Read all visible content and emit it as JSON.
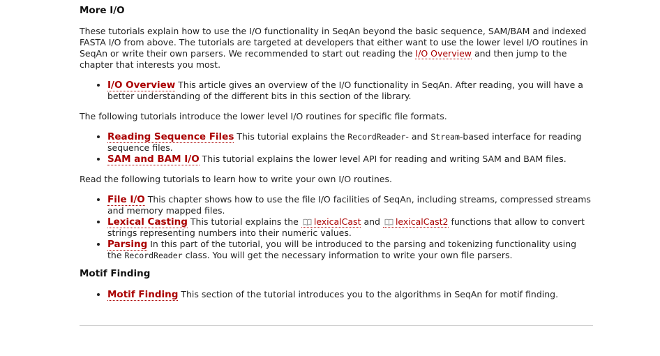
{
  "section_io": {
    "title": "More I/O",
    "intro_part1": "These tutorials explain how to use the I/O functionality in SeqAn beyond the basic sequence, SAM/BAM and indexed FASTA I/O from above. The tutorials are targeted at developers that either want to use the lower level I/O routines in SeqAn or write their own parsers. We recommended to start out reading the ",
    "intro_link": "I/O Overview",
    "intro_part2": " and then jump to the chapter that interests you most.",
    "overview_item": {
      "link": "I/O Overview",
      "text": " This article gives an overview of the I/O functionality in SeqAn. After reading, you will have a better understanding of the different bits in this section of the library."
    },
    "lower_level_intro": "The following tutorials introduce the lower level I/O routines for specific file formats.",
    "lower_level_items": [
      {
        "link": "Reading Sequence Files",
        "text_before": " This tutorial explains the ",
        "code1": "RecordReader",
        "text_middle": "- and ",
        "code2": "Stream",
        "text_after": "-based interface for reading sequence files."
      },
      {
        "link": "SAM and BAM I/O",
        "text": " This tutorial explains the lower level API for reading and writing SAM and BAM files."
      }
    ],
    "own_routines_intro": "Read the following tutorials to learn how to write your own I/O routines.",
    "own_routines_items": [
      {
        "link": "File I/O",
        "text": " This chapter shows how to use the file I/O facilities of SeqAn, including streams, compressed streams and memory mapped files."
      },
      {
        "link": "Lexical Casting",
        "text_before": " This tutorial explains the ",
        "api1": "lexicalCast",
        "text_middle": " and ",
        "api2": "lexicalCast2",
        "text_after": " functions that allow to convert strings representing numbers into their numeric values."
      },
      {
        "link": "Parsing",
        "text_before": " In this part of the tutorial, you will be introduced to the parsing and tokenizing functionality using the ",
        "code": "RecordReader",
        "text_after": " class. You will get the necessary information to write your own file parsers."
      }
    ]
  },
  "section_motif": {
    "title": "Motif Finding",
    "item": {
      "link": "Motif Finding",
      "text": " This section of the tutorial introduces you to the algorithms in SeqAn for motif finding."
    }
  },
  "colors": {
    "link": "#aa0000",
    "text": "#222222",
    "rule": "#cccccc"
  },
  "icons": {
    "api": "book-icon"
  }
}
